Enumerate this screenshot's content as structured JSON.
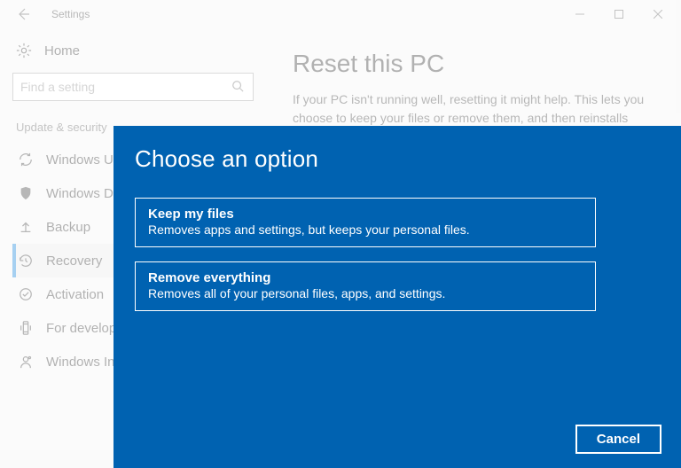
{
  "window": {
    "title": "Settings"
  },
  "home": {
    "label": "Home"
  },
  "search": {
    "placeholder": "Find a setting"
  },
  "section": {
    "header": "Update & security"
  },
  "nav": {
    "items": [
      {
        "label": "Windows Update"
      },
      {
        "label": "Windows Defender"
      },
      {
        "label": "Backup"
      },
      {
        "label": "Recovery"
      },
      {
        "label": "Activation"
      },
      {
        "label": "For developers"
      },
      {
        "label": "Windows Insider"
      }
    ]
  },
  "main": {
    "heading": "Reset this PC",
    "body": "If your PC isn't running well, resetting it might help. This lets you choose to keep your files or remove them, and then reinstalls"
  },
  "modal": {
    "title": "Choose an option",
    "options": [
      {
        "title": "Keep my files",
        "desc": "Removes apps and settings, but keeps your personal files."
      },
      {
        "title": "Remove everything",
        "desc": "Removes all of your personal files, apps, and settings."
      }
    ],
    "cancel": "Cancel"
  }
}
